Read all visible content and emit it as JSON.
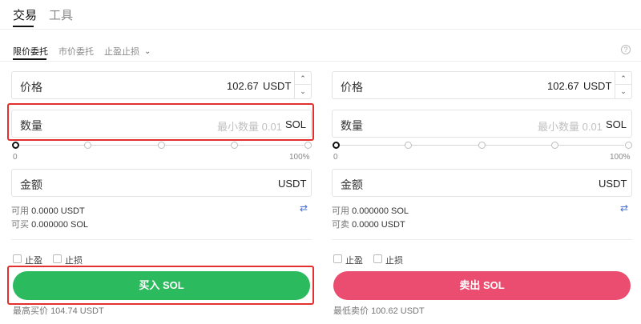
{
  "top_tabs": [
    {
      "label": "交易"
    },
    {
      "label": "工具"
    }
  ],
  "order_types": {
    "limit": "限价委托",
    "market": "市价委托",
    "tpsl": "止盈止损"
  },
  "buy": {
    "price_label": "价格",
    "price_value": "102.67",
    "price_unit": "USDT",
    "qty_label": "数量",
    "qty_placeholder": "最小数量 0.01",
    "qty_unit": "SOL",
    "slider_min": "0",
    "slider_max": "100%",
    "slider_percent": 0,
    "amount_label": "金额",
    "amount_unit": "USDT",
    "available_label": "可用",
    "available_value": "0.0000 USDT",
    "can_label": "可买",
    "can_value": "0.000000 SOL",
    "tp_label": "止盈",
    "sl_label": "止损",
    "button": "买入 SOL",
    "best_label": "最高买价",
    "best_value": "104.74 USDT"
  },
  "sell": {
    "price_label": "价格",
    "price_value": "102.67",
    "price_unit": "USDT",
    "qty_label": "数量",
    "qty_placeholder": "最小数量 0.01",
    "qty_unit": "SOL",
    "slider_min": "0",
    "slider_max": "100%",
    "slider_percent": 0,
    "amount_label": "金额",
    "amount_unit": "USDT",
    "available_label": "可用",
    "available_value": "0.000000 SOL",
    "can_label": "可卖",
    "can_value": "0.0000 USDT",
    "tp_label": "止盈",
    "sl_label": "止损",
    "button": "卖出 SOL",
    "best_label": "最低卖价",
    "best_value": "100.62 USDT"
  },
  "icons": {
    "stepper_up": "chevron-up-icon",
    "stepper_down": "chevron-down-icon",
    "swap": "swap-icon",
    "help": "help-icon"
  },
  "colors": {
    "buy": "#2bba5d",
    "sell": "#ea4d6f",
    "highlight": "#e3302f",
    "swap": "#4a6fd6"
  }
}
